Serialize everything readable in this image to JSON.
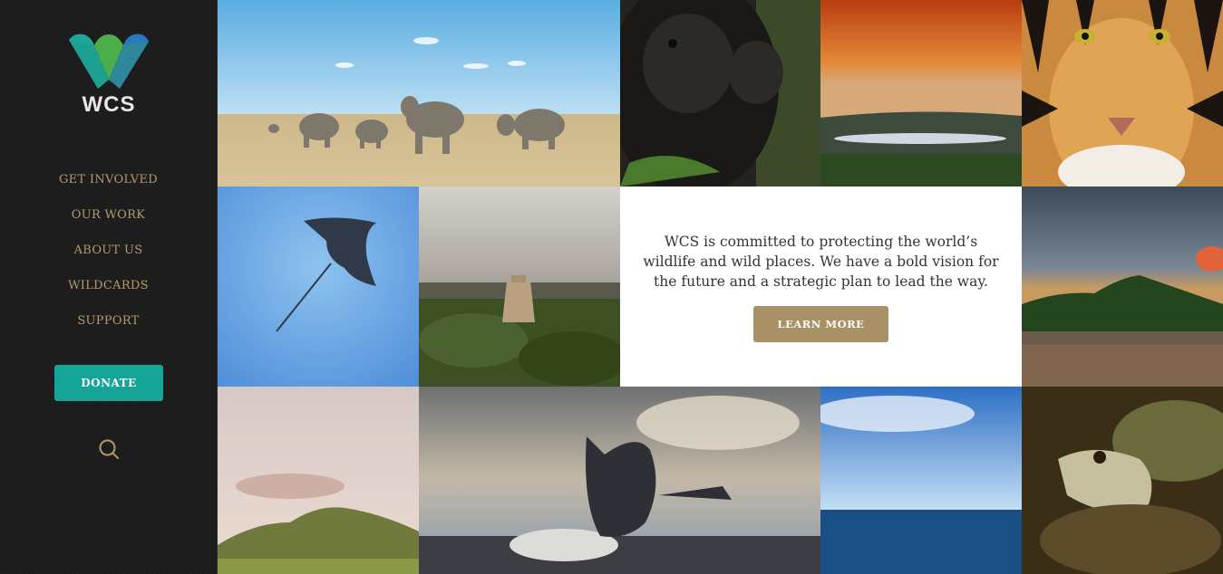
{
  "brand": {
    "logo_text": "WCS"
  },
  "nav": {
    "items": [
      {
        "label": "GET INVOLVED"
      },
      {
        "label": "OUR WORK"
      },
      {
        "label": "ABOUT US"
      },
      {
        "label": "WILDCARDS"
      },
      {
        "label": "SUPPORT"
      }
    ],
    "donate_label": "DONATE",
    "search_icon": "search-icon"
  },
  "mission": {
    "text": "WCS is committed to protecting the world’s wildlife and wild places. We have a bold vision for the future and a strategic plan to lead the way.",
    "button_label": "LEARN MORE"
  },
  "colors": {
    "sidebar_bg": "#1d1c1c",
    "nav_text": "#b59b6c",
    "donate": "#14a596",
    "learn_more": "#a89165"
  }
}
